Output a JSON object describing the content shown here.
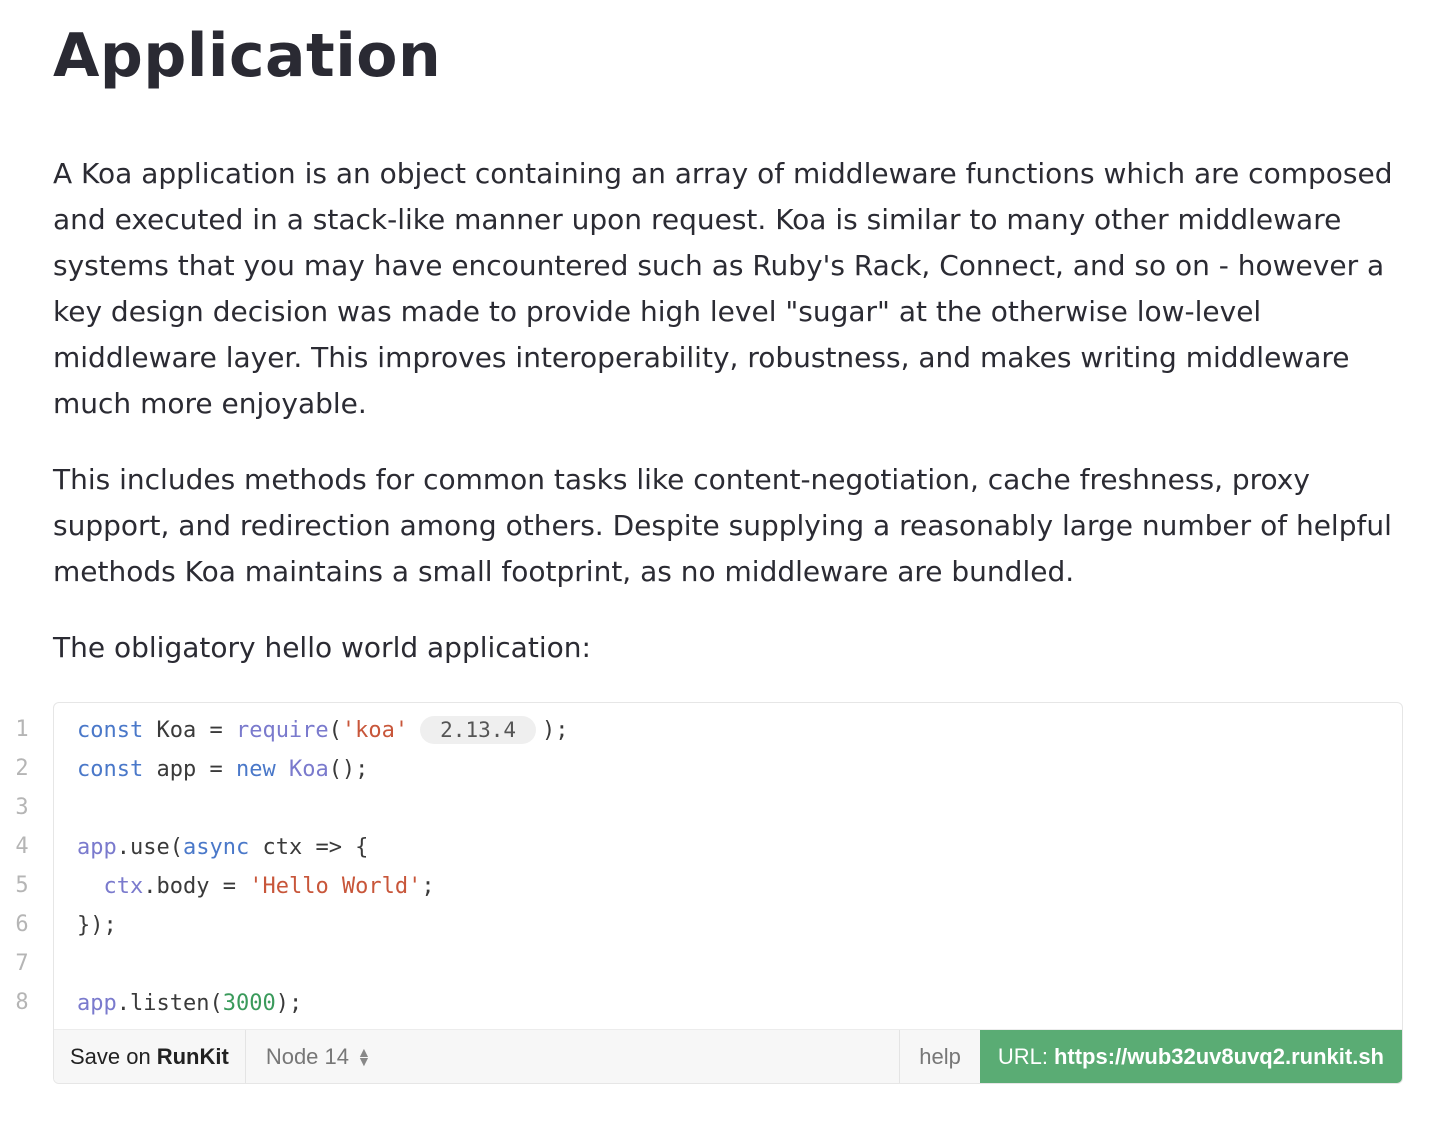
{
  "title": "Application",
  "paragraphs": [
    "A Koa application is an object containing an array of middleware functions which are composed and executed in a stack-like manner upon request. Koa is similar to many other middleware systems that you may have encountered such as Ruby's Rack, Connect, and so on - however a key design decision was made to provide high level \"sugar\" at the otherwise low-level middleware layer. This improves interoperability, robustness, and makes writing middleware much more enjoyable.",
    "This includes methods for common tasks like content-negotiation, cache freshness, proxy support, and redirection among others. Despite supplying a reasonably large number of helpful methods Koa maintains a small footprint, as no middleware are bundled.",
    "The obligatory hello world application:"
  ],
  "code": {
    "line_numbers": [
      "1",
      "2",
      "3",
      "4",
      "5",
      "6",
      "7",
      "8"
    ],
    "koa_version": "2.13.4",
    "tokens": {
      "const": "const",
      "koa": " Koa = ",
      "require": "require",
      "paren_open": "(",
      "koa_str": "'koa'",
      "close1": ");",
      "app_decl": " app = ",
      "new": "new",
      "koa_ctor": " Koa",
      "call_end": "();",
      "app": "app",
      "use": ".use(",
      "async": "async",
      "arrow": " ctx => {",
      "indent": "  ",
      "ctx": "ctx",
      "body_assign": ".body = ",
      "hello": "'Hello World'",
      "semicolon": ";",
      "close_block": "});",
      "listen": ".listen(",
      "port": "3000",
      "listen_end": ");"
    }
  },
  "footer": {
    "save_prefix": "Save on",
    "save_brand": "RunKit",
    "node_version": "Node 14",
    "help": "help",
    "url_label": "URL:",
    "url_value": "https://wub32uv8uvq2.runkit.sh"
  },
  "colors": {
    "keyword": "#4a78c9",
    "function": "#7a7acd",
    "string": "#c8563a",
    "number": "#3a9a5b",
    "url_bar": "#5aac74"
  }
}
